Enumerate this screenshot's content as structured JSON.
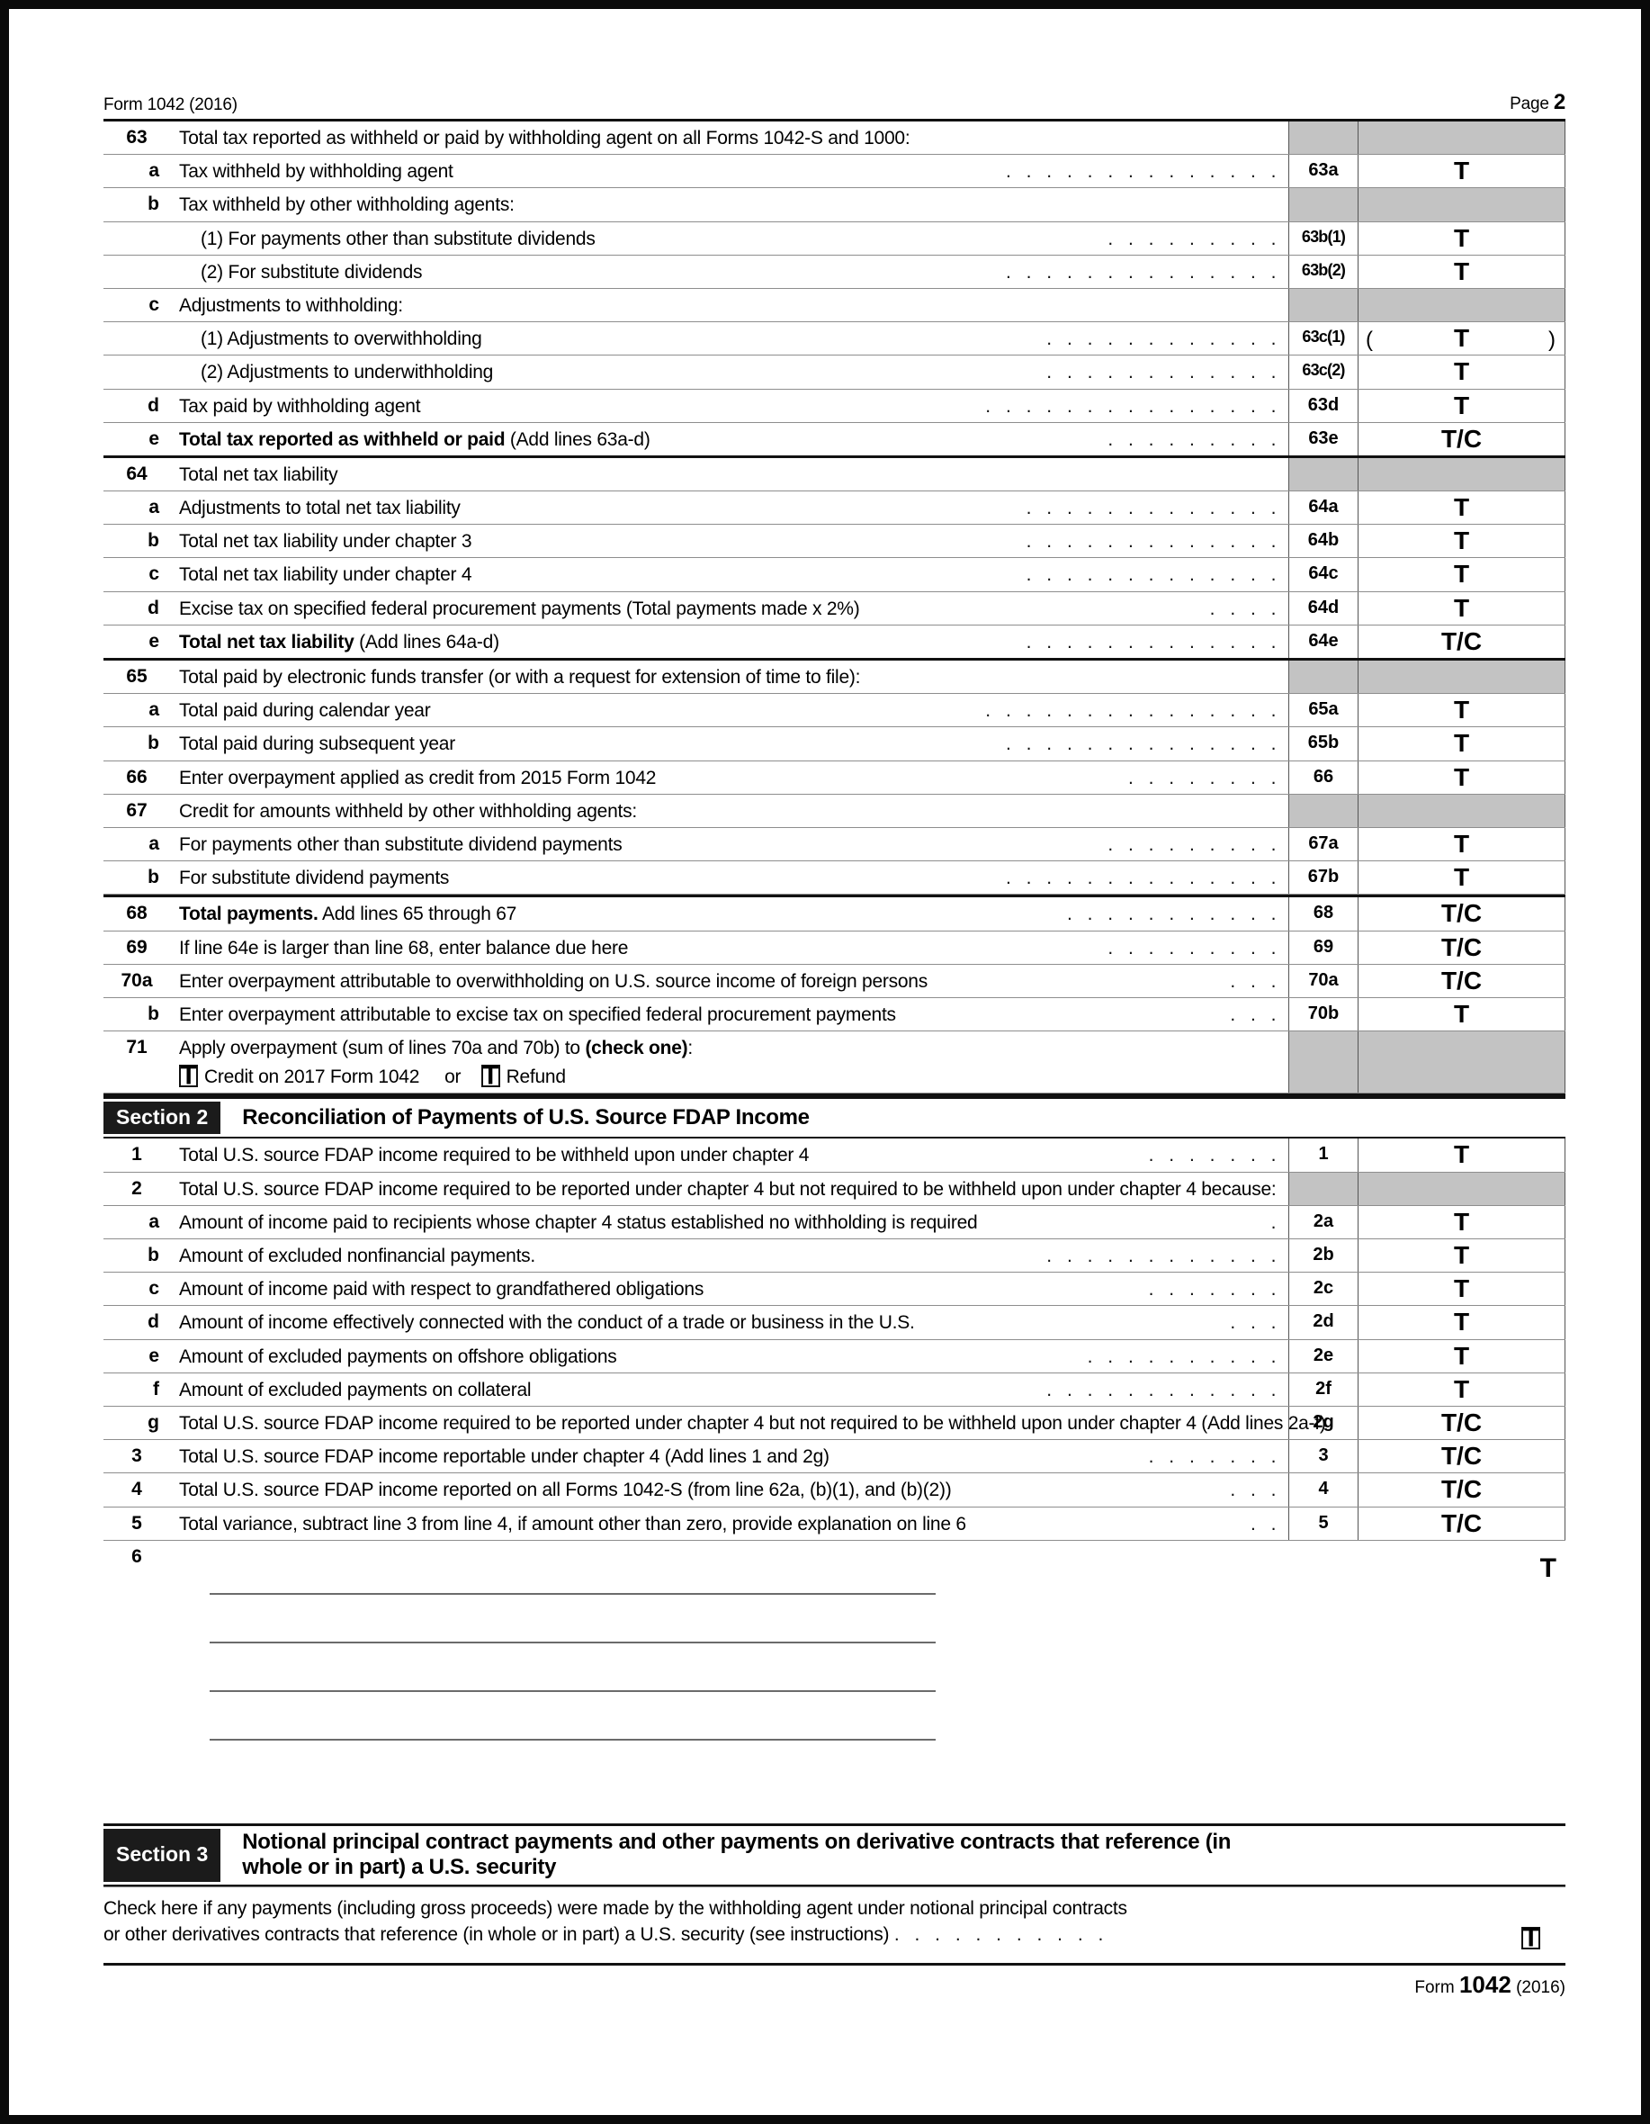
{
  "header": {
    "left": "Form 1042 (2016)",
    "page_label": "Page",
    "page_number": "2"
  },
  "section1": {
    "rows": [
      {
        "num": "63",
        "letter": "",
        "text": "Total tax reported as withheld or paid by withholding agent on all Forms 1042-S and 1000:",
        "dots": "",
        "lineno": "",
        "amount": "",
        "shaded": true,
        "indent": 0
      },
      {
        "num": "",
        "letter": "a",
        "text": "Tax withheld by withholding agent",
        "dots": ". . . . . . . . . . . . . .",
        "lineno": "63a",
        "amount": "T",
        "shaded": false,
        "indent": 0
      },
      {
        "num": "",
        "letter": "b",
        "text": "Tax withheld by other withholding agents:",
        "dots": "",
        "lineno": "",
        "amount": "",
        "shaded": true,
        "indent": 0
      },
      {
        "num": "",
        "letter": "",
        "text": "(1) For payments other than substitute dividends",
        "dots": ". . . . . . . . .",
        "lineno": "63b(1)",
        "amount": "T",
        "shaded": false,
        "indent": 1
      },
      {
        "num": "",
        "letter": "",
        "text": "(2) For substitute dividends",
        "dots": ". . . . . . . . . . . . . .",
        "lineno": "63b(2)",
        "amount": "T",
        "shaded": false,
        "indent": 1
      },
      {
        "num": "",
        "letter": "c",
        "text": "Adjustments to withholding:",
        "dots": "",
        "lineno": "",
        "amount": "",
        "shaded": true,
        "indent": 0
      },
      {
        "num": "",
        "letter": "",
        "text": "(1) Adjustments to overwithholding",
        "dots": ". . . . . . . . . . . .",
        "lineno": "63c(1)",
        "amount": "T",
        "shaded": false,
        "indent": 1,
        "parens": true
      },
      {
        "num": "",
        "letter": "",
        "text": "(2) Adjustments to underwithholding",
        "dots": ". . . . . . . . . . . .",
        "lineno": "63c(2)",
        "amount": "T",
        "shaded": false,
        "indent": 1
      },
      {
        "num": "",
        "letter": "d",
        "text": "Tax paid by withholding agent",
        "dots": ". . . . . . . . . . . . . . .",
        "lineno": "63d",
        "amount": "T",
        "shaded": false,
        "indent": 0
      },
      {
        "num": "",
        "letter": "e",
        "text_bold": "Total tax reported as withheld or paid",
        "text": " (Add lines 63a-d)",
        "dots": ". . . . . . . . .",
        "lineno": "63e",
        "amount": "T/C",
        "shaded": false,
        "indent": 0,
        "thick_bottom": true
      },
      {
        "num": "64",
        "letter": "",
        "text": "Total net tax liability",
        "dots": "",
        "lineno": "",
        "amount": "",
        "shaded": true,
        "indent": 0
      },
      {
        "num": "",
        "letter": "a",
        "text": "Adjustments to total net tax liability",
        "dots": ". . . . . . . . . . . . .",
        "lineno": "64a",
        "amount": "T",
        "shaded": false,
        "indent": 0
      },
      {
        "num": "",
        "letter": "b",
        "text": "Total net tax liability under chapter 3",
        "dots": ". . . . . . . . . . . . .",
        "lineno": "64b",
        "amount": "T",
        "shaded": false,
        "indent": 0
      },
      {
        "num": "",
        "letter": "c",
        "text": "Total net tax liability under chapter 4",
        "dots": ". . . . . . . . . . . . .",
        "lineno": "64c",
        "amount": "T",
        "shaded": false,
        "indent": 0
      },
      {
        "num": "",
        "letter": "d",
        "text": "Excise tax on specified federal procurement payments (Total payments made x 2%)",
        "dots": ". . . .",
        "lineno": "64d",
        "amount": "T",
        "shaded": false,
        "indent": 0
      },
      {
        "num": "",
        "letter": "e",
        "text_bold": "Total net tax liability",
        "text": " (Add lines 64a-d)",
        "dots": ". . . . . . . . . . . . .",
        "lineno": "64e",
        "amount": "T/C",
        "shaded": false,
        "indent": 0,
        "thick_bottom": true
      },
      {
        "num": "65",
        "letter": "",
        "text": "Total paid by electronic funds transfer (or with a request for extension of time to file):",
        "dots": "",
        "lineno": "",
        "amount": "",
        "shaded": true,
        "indent": 0
      },
      {
        "num": "",
        "letter": "a",
        "text": "Total paid during calendar year",
        "dots": ". . . . . . . . . . . . . . .",
        "lineno": "65a",
        "amount": "T",
        "shaded": false,
        "indent": 0
      },
      {
        "num": "",
        "letter": "b",
        "text": "Total paid during subsequent year",
        "dots": ". . . . . . . . . . . . . .",
        "lineno": "65b",
        "amount": "T",
        "shaded": false,
        "indent": 0
      },
      {
        "num": "66",
        "letter": "",
        "text": "Enter overpayment applied as credit from 2015 Form 1042",
        "dots": ". . . . . . . .",
        "lineno": "66",
        "amount": "T",
        "shaded": false,
        "indent": 0
      },
      {
        "num": "67",
        "letter": "",
        "text": "Credit for amounts withheld by other withholding agents:",
        "dots": "",
        "lineno": "",
        "amount": "",
        "shaded": true,
        "indent": 0
      },
      {
        "num": "",
        "letter": "a",
        "text": "For payments other than substitute dividend payments",
        "dots": ". . . . . . . . .",
        "lineno": "67a",
        "amount": "T",
        "shaded": false,
        "indent": 0
      },
      {
        "num": "",
        "letter": "b",
        "text": "For substitute dividend payments",
        "dots": ". . . . . . . . . . . . . .",
        "lineno": "67b",
        "amount": "T",
        "shaded": false,
        "indent": 0
      },
      {
        "num": "68",
        "letter": "",
        "text_bold": "Total payments.",
        "text": " Add lines 65 through 67",
        "dots": ". . . . . . . . . . .",
        "lineno": "68",
        "amount": "T/C",
        "shaded": false,
        "indent": 0,
        "thick_top": true
      },
      {
        "num": "69",
        "letter": "",
        "text": "If line 64e is larger than line 68, enter balance due here",
        "dots": ". . . . . . . . .",
        "lineno": "69",
        "amount": "T/C",
        "shaded": false,
        "indent": 0
      },
      {
        "num": "70a",
        "letter": "",
        "text": "Enter overpayment attributable to overwithholding on U.S. source income of foreign persons",
        "dots": ". . .",
        "lineno": "70a",
        "amount": "T/C",
        "shaded": false,
        "indent": 0
      },
      {
        "num": "",
        "letter": "b",
        "text": "Enter overpayment attributable to excise tax on specified federal procurement payments",
        "dots": ". . .",
        "lineno": "70b",
        "amount": "T",
        "shaded": false,
        "indent": 0
      },
      {
        "num": "71",
        "letter": "",
        "text_bold_tail": "(check one)",
        "text": "Apply overpayment (sum of lines 70a and 70b) to ",
        "text_tail": ":",
        "dots": "",
        "lineno": "",
        "amount": "",
        "shaded": true,
        "indent": 0,
        "checkline": true
      }
    ],
    "checkboxes": {
      "credit_label": "Credit on 2017 Form 1042",
      "or_label": "or",
      "refund_label": "Refund"
    }
  },
  "section2": {
    "tag": "Section 2",
    "title": "Reconciliation of Payments of U.S. Source FDAP Income",
    "rows": [
      {
        "num": "1",
        "letter": "",
        "text": "Total U.S. source FDAP income required to be withheld upon under chapter 4",
        "dots": ". . . . . . .",
        "lineno": "1",
        "amount": "T",
        "shaded": false,
        "indent": 0
      },
      {
        "num": "2",
        "letter": "",
        "text": "Total U.S. source FDAP income required to be reported under chapter 4 but not required to be withheld upon under chapter 4 because:",
        "dots": "",
        "lineno": "",
        "amount": "",
        "shaded": true,
        "indent": 0,
        "justify": true,
        "twoline": true
      },
      {
        "num": "",
        "letter": "a",
        "text": "Amount of income paid to recipients whose chapter 4 status established no withholding is required",
        "dots": ".",
        "lineno": "2a",
        "amount": "T",
        "shaded": false,
        "indent": 0
      },
      {
        "num": "",
        "letter": "b",
        "text": "Amount of excluded nonfinancial payments.",
        "dots": ". . . . . . . . . . . .",
        "lineno": "2b",
        "amount": "T",
        "shaded": false,
        "indent": 0
      },
      {
        "num": "",
        "letter": "c",
        "text": "Amount of income paid with respect to grandfathered obligations",
        "dots": ". . . . . . .",
        "lineno": "2c",
        "amount": "T",
        "shaded": false,
        "indent": 0
      },
      {
        "num": "",
        "letter": "d",
        "text": "Amount of income effectively connected with the conduct of a trade or business in the U.S.",
        "dots": ". . .",
        "lineno": "2d",
        "amount": "T",
        "shaded": false,
        "indent": 0
      },
      {
        "num": "",
        "letter": "e",
        "text": "Amount of excluded payments on offshore obligations",
        "dots": ". . . . . . . . . .",
        "lineno": "2e",
        "amount": "T",
        "shaded": false,
        "indent": 0
      },
      {
        "num": "",
        "letter": "f",
        "text": "Amount of excluded payments on collateral",
        "dots": ". . . . . . . . . . . .",
        "lineno": "2f",
        "amount": "T",
        "shaded": false,
        "indent": 0
      },
      {
        "num": "",
        "letter": "g",
        "text": "Total U.S. source FDAP income required to be reported under chapter 4 but not required to be withheld upon under chapter 4 (Add lines 2a-f)",
        "dots": ". . . . . . . . . . . .",
        "lineno": "2g",
        "amount": "T/C",
        "shaded": false,
        "indent": 0,
        "twoline": true
      },
      {
        "num": "3",
        "letter": "",
        "text": "Total U.S. source FDAP income reportable under chapter 4 (Add lines 1 and 2g)",
        "dots": ". . . . . . .",
        "lineno": "3",
        "amount": "T/C",
        "shaded": false,
        "indent": 0
      },
      {
        "num": "4",
        "letter": "",
        "text": "Total U.S. source FDAP income reported on all Forms 1042-S (from line 62a, (b)(1), and (b)(2))",
        "dots": ". . .",
        "lineno": "4",
        "amount": "T/C",
        "shaded": false,
        "indent": 0
      },
      {
        "num": "5",
        "letter": "",
        "text": "Total variance, subtract line 3 from line 4, if amount other than zero, provide explanation on line 6",
        "dots": ". .",
        "lineno": "5",
        "amount": "T/C",
        "shaded": false,
        "indent": 0
      },
      {
        "num": "6",
        "letter": "",
        "text": "",
        "dots": "",
        "lineno": "",
        "amount": "",
        "shaded": false,
        "indent": 0,
        "writelines": 4
      }
    ],
    "line6_marker": "T"
  },
  "section3": {
    "tag": "Section 3",
    "title_line1": "Notional principal contract payments and other payments on derivative contracts that reference (in",
    "title_line2": "whole or in part) a U.S. security",
    "body_line1": "Check here if any payments (including gross proceeds) were made by the withholding agent under notional principal contracts",
    "body_line2": "or other derivatives contracts that reference (in whole or in part) a U.S. security (see instructions)",
    "body_dots": ". . . . . . . . . . ."
  },
  "footer": {
    "prefix": "Form",
    "number": "1042",
    "year": "(2016)"
  },
  "colors": {
    "shade": "#c3c3c3",
    "rule": "#8e8e8e",
    "heavy_rule": "#111111",
    "section_tag_bg": "#1b1b1b",
    "section_tag_fg": "#ffffff"
  }
}
